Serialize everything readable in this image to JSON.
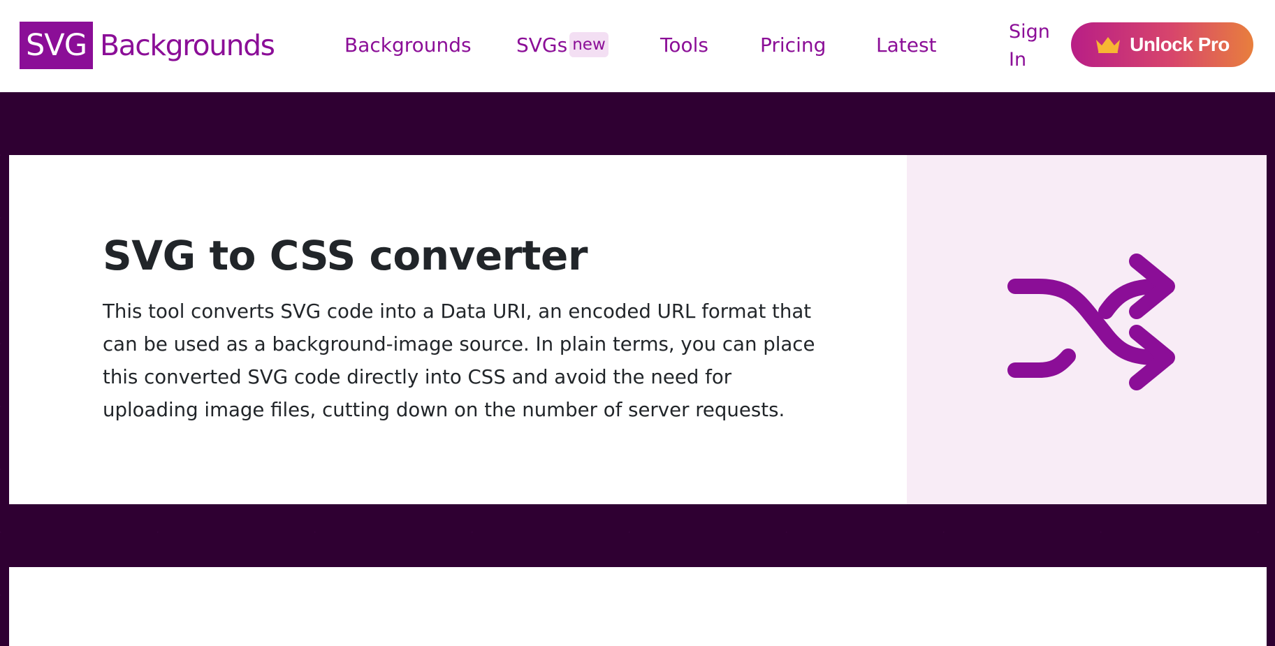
{
  "header": {
    "logo": {
      "box_text": "SVG",
      "text": "Backgrounds"
    },
    "nav": [
      {
        "label": "Backgrounds"
      },
      {
        "label": "SVGs",
        "badge": "new"
      },
      {
        "label": "Tools"
      },
      {
        "label": "Pricing"
      },
      {
        "label": "Latest"
      }
    ],
    "sign_in": "Sign In",
    "cta": {
      "label": "Unlock Pro",
      "icon": "crown-icon"
    }
  },
  "hero": {
    "title": "SVG to CSS converter",
    "description": "This tool converts SVG code into a Data URI, an encoded URL format that can be used as a background-image source. In plain terms, you can place this converted SVG code directly into CSS and avoid the need for uploading image files, cutting down on the number of server requests.",
    "icon": "shuffle-icon"
  },
  "colors": {
    "brand": "#8b0e97",
    "dark_background": "#2f0032",
    "hero_visual_background": "#f8ecf6",
    "text": "#212529",
    "cta_gradient": [
      "#b81e86",
      "#e87f3d"
    ]
  }
}
